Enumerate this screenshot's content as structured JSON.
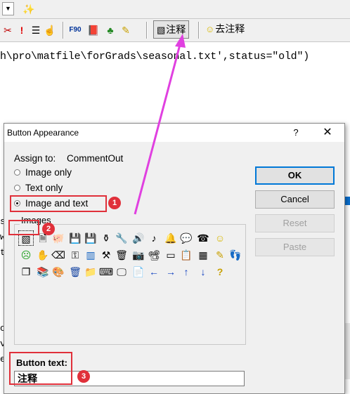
{
  "editor": {
    "code_line": "h\\pro\\matfile\\forGrads\\seasonal.txt',status=\"old\")",
    "side_fragments": [
      "s",
      "w",
      "t",
      "o",
      "v",
      "e"
    ]
  },
  "toolbar": {
    "buttons": [
      {
        "name": "comment-out-button",
        "icon": "comment-icon",
        "label": "注释"
      },
      {
        "name": "uncomment-button",
        "icon": "smiley-icon",
        "label": "去注释"
      }
    ]
  },
  "dialog": {
    "title": "Button Appearance",
    "help": "?",
    "close": "✕",
    "assign_label": "Assign to:",
    "assign_value": "CommentOut",
    "radios": [
      {
        "label": "Image only",
        "checked": false
      },
      {
        "label": "Text only",
        "checked": false
      },
      {
        "label": "Image and text",
        "checked": true
      }
    ],
    "images_label": "Images",
    "buttons": {
      "ok": "OK",
      "cancel": "Cancel",
      "reset": "Reset",
      "paste": "Paste"
    },
    "button_text_label": "Button text:",
    "button_text_value": "注释",
    "badges": [
      "1",
      "2",
      "3"
    ]
  },
  "colors": {
    "annotation_red": "#e0303a",
    "arrow_magenta": "#e040e0",
    "default_button_border": "#0078d7"
  }
}
